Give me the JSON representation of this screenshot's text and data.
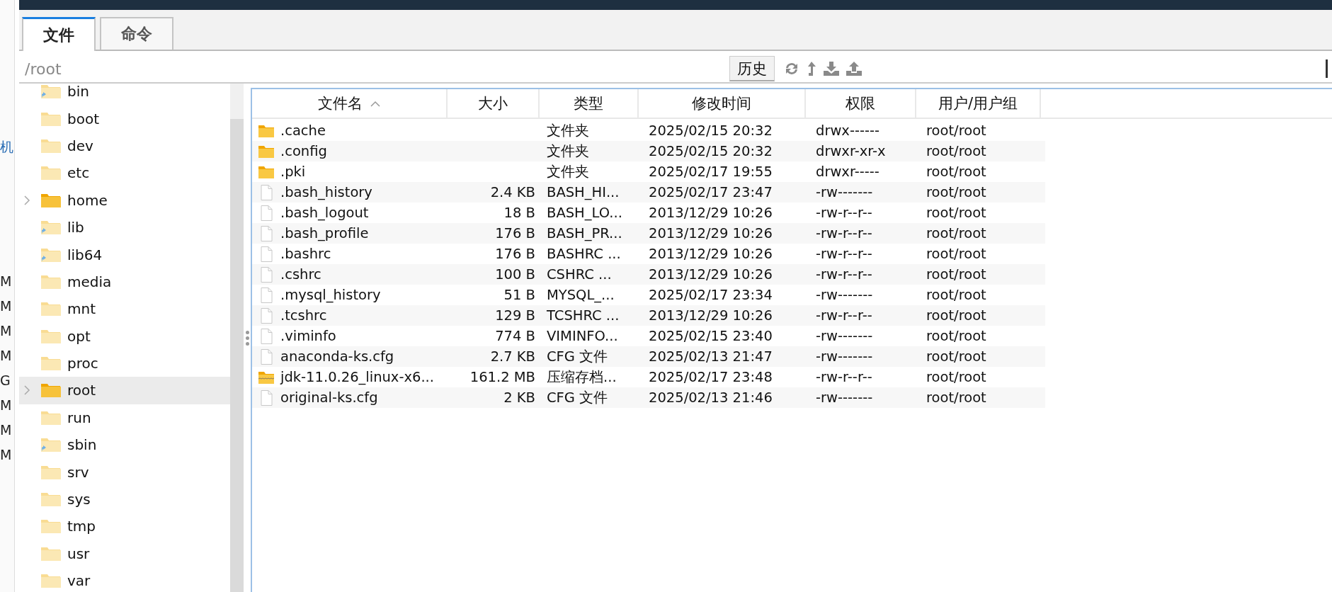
{
  "side_strip": {
    "labels": [
      "机",
      "M",
      "M",
      "M",
      "M",
      "G",
      "M",
      "M",
      "M"
    ]
  },
  "tabs": [
    {
      "label": "文件",
      "selected": true
    },
    {
      "label": "命令",
      "selected": false
    }
  ],
  "path_bar": {
    "value": "/root",
    "history_button": "历史"
  },
  "tree": {
    "items": [
      {
        "name": "bin",
        "kind": "link",
        "expandable": false,
        "selected": false
      },
      {
        "name": "boot",
        "kind": "folder",
        "expandable": false,
        "selected": false
      },
      {
        "name": "dev",
        "kind": "folder",
        "expandable": false,
        "selected": false
      },
      {
        "name": "etc",
        "kind": "folder",
        "expandable": false,
        "selected": false
      },
      {
        "name": "home",
        "kind": "folder",
        "expandable": true,
        "selected": false
      },
      {
        "name": "lib",
        "kind": "link",
        "expandable": false,
        "selected": false
      },
      {
        "name": "lib64",
        "kind": "link",
        "expandable": false,
        "selected": false
      },
      {
        "name": "media",
        "kind": "folder",
        "expandable": false,
        "selected": false
      },
      {
        "name": "mnt",
        "kind": "folder",
        "expandable": false,
        "selected": false
      },
      {
        "name": "opt",
        "kind": "folder",
        "expandable": false,
        "selected": false
      },
      {
        "name": "proc",
        "kind": "folder",
        "expandable": false,
        "selected": false
      },
      {
        "name": "root",
        "kind": "folder",
        "expandable": true,
        "selected": true
      },
      {
        "name": "run",
        "kind": "folder",
        "expandable": false,
        "selected": false
      },
      {
        "name": "sbin",
        "kind": "link",
        "expandable": false,
        "selected": false
      },
      {
        "name": "srv",
        "kind": "folder",
        "expandable": false,
        "selected": false
      },
      {
        "name": "sys",
        "kind": "folder",
        "expandable": false,
        "selected": false
      },
      {
        "name": "tmp",
        "kind": "folder",
        "expandable": false,
        "selected": false
      },
      {
        "name": "usr",
        "kind": "folder",
        "expandable": false,
        "selected": false
      },
      {
        "name": "var",
        "kind": "folder",
        "expandable": false,
        "selected": false
      }
    ]
  },
  "table": {
    "columns": [
      {
        "label": "文件名",
        "sorted": true
      },
      {
        "label": "大小",
        "sorted": false
      },
      {
        "label": "类型",
        "sorted": false
      },
      {
        "label": "修改时间",
        "sorted": false
      },
      {
        "label": "权限",
        "sorted": false
      },
      {
        "label": "用户/用户组",
        "sorted": false
      }
    ],
    "rows": [
      {
        "kind": "folder",
        "cells": [
          ".cache",
          "",
          "文件夹",
          "2025/02/15 20:32",
          "drwx------",
          "root/root"
        ]
      },
      {
        "kind": "folder",
        "cells": [
          ".config",
          "",
          "文件夹",
          "2025/02/15 20:32",
          "drwxr-xr-x",
          "root/root"
        ]
      },
      {
        "kind": "folder",
        "cells": [
          ".pki",
          "",
          "文件夹",
          "2025/02/17 19:55",
          "drwxr-----",
          "root/root"
        ]
      },
      {
        "kind": "file",
        "cells": [
          ".bash_history",
          "2.4 KB",
          "BASH_HI...",
          "2025/02/17 23:47",
          "-rw-------",
          "root/root"
        ]
      },
      {
        "kind": "file",
        "cells": [
          ".bash_logout",
          "18 B",
          "BASH_LO...",
          "2013/12/29 10:26",
          "-rw-r--r--",
          "root/root"
        ]
      },
      {
        "kind": "file",
        "cells": [
          ".bash_profile",
          "176 B",
          "BASH_PR...",
          "2013/12/29 10:26",
          "-rw-r--r--",
          "root/root"
        ]
      },
      {
        "kind": "file",
        "cells": [
          ".bashrc",
          "176 B",
          "BASHRC ...",
          "2013/12/29 10:26",
          "-rw-r--r--",
          "root/root"
        ]
      },
      {
        "kind": "file",
        "cells": [
          ".cshrc",
          "100 B",
          "CSHRC ...",
          "2013/12/29 10:26",
          "-rw-r--r--",
          "root/root"
        ]
      },
      {
        "kind": "file",
        "cells": [
          ".mysql_history",
          "51 B",
          "MYSQL_...",
          "2025/02/17 23:34",
          "-rw-------",
          "root/root"
        ]
      },
      {
        "kind": "file",
        "cells": [
          ".tcshrc",
          "129 B",
          "TCSHRC ...",
          "2013/12/29 10:26",
          "-rw-r--r--",
          "root/root"
        ]
      },
      {
        "kind": "file",
        "cells": [
          ".viminfo",
          "774 B",
          "VIMINFO...",
          "2025/02/15 23:40",
          "-rw-------",
          "root/root"
        ]
      },
      {
        "kind": "file",
        "cells": [
          "anaconda-ks.cfg",
          "2.7 KB",
          "CFG 文件",
          "2025/02/13 21:47",
          "-rw-------",
          "root/root"
        ]
      },
      {
        "kind": "archive",
        "cells": [
          "jdk-11.0.26_linux-x6...",
          "161.2 MB",
          "压缩存档...",
          "2025/02/17 23:48",
          "-rw-r--r--",
          "root/root"
        ]
      },
      {
        "kind": "file",
        "cells": [
          "original-ks.cfg",
          "2 KB",
          "CFG 文件",
          "2025/02/13 21:46",
          "-rw-------",
          "root/root"
        ]
      }
    ]
  }
}
